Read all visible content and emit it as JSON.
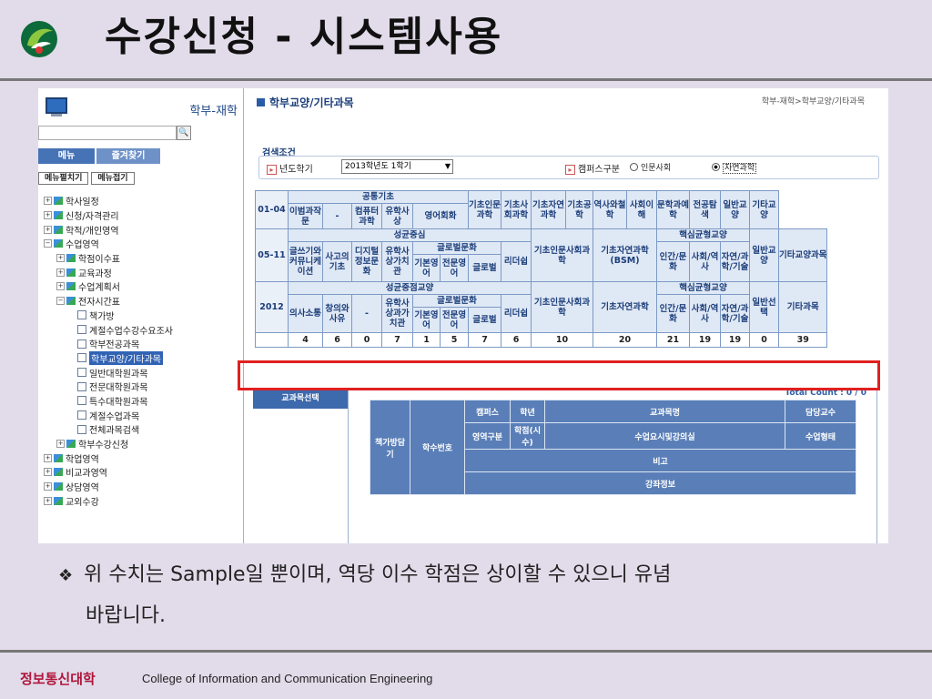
{
  "slide": {
    "title": "수강신청 - 시스템사용",
    "logo_icon": "university-emblem-icon",
    "bullet": "위 수치는 Sample일 뿐이며, 역당 이수 학점은 상이할 수 있으니 유념",
    "bullet2": "바랍니다.",
    "footer_kr": "정보통신대학",
    "footer_en": "College of Information and Communication Engineering",
    "highlight_color": "#e02020"
  },
  "sidebar": {
    "title": "학부-재학",
    "search_button": "🔍",
    "tab_menu": "메뉴",
    "tab_fav": "즐겨찾기",
    "expand": "메뉴펼치기",
    "collapse": "메뉴접기",
    "items": [
      {
        "label": "학사일정",
        "pm": "+",
        "icon": "g",
        "indent": 0
      },
      {
        "label": "신청/자격관리",
        "pm": "+",
        "icon": "g",
        "indent": 0
      },
      {
        "label": "학적/개인영역",
        "pm": "+",
        "icon": "g",
        "indent": 0
      },
      {
        "label": "수업영역",
        "pm": "−",
        "icon": "g",
        "indent": 0
      },
      {
        "label": "학점이수표",
        "pm": "+",
        "icon": "g",
        "indent": 1
      },
      {
        "label": "교육과정",
        "pm": "+",
        "icon": "g",
        "indent": 1
      },
      {
        "label": "수업계획서",
        "pm": "+",
        "icon": "g",
        "indent": 1
      },
      {
        "label": "전자시간표",
        "pm": "−",
        "icon": "g",
        "indent": 1
      },
      {
        "label": "책가방",
        "pm": "",
        "icon": "d",
        "indent": 2
      },
      {
        "label": "계절수업수강수요조사",
        "pm": "",
        "icon": "d",
        "indent": 2
      },
      {
        "label": "학부전공과목",
        "pm": "",
        "icon": "d",
        "indent": 2
      },
      {
        "label": "학부교양/기타과목",
        "pm": "",
        "icon": "d",
        "indent": 2,
        "selected": true
      },
      {
        "label": "일반대학원과목",
        "pm": "",
        "icon": "d",
        "indent": 2
      },
      {
        "label": "전문대학원과목",
        "pm": "",
        "icon": "d",
        "indent": 2
      },
      {
        "label": "특수대학원과목",
        "pm": "",
        "icon": "d",
        "indent": 2
      },
      {
        "label": "계절수업과목",
        "pm": "",
        "icon": "d",
        "indent": 2
      },
      {
        "label": "전체과목검색",
        "pm": "",
        "icon": "d",
        "indent": 2
      },
      {
        "label": "학부수강신청",
        "pm": "+",
        "icon": "g",
        "indent": 1
      },
      {
        "label": "학업영역",
        "pm": "+",
        "icon": "g",
        "indent": 0
      },
      {
        "label": "비교과영역",
        "pm": "+",
        "icon": "g",
        "indent": 0
      },
      {
        "label": "상담영역",
        "pm": "+",
        "icon": "g",
        "indent": 0
      },
      {
        "label": "교외수강",
        "pm": "+",
        "icon": "g",
        "indent": 0
      }
    ]
  },
  "main": {
    "page_title": "학부교양/기타과목",
    "breadcrumb": "학부-재학>학부교양/기타과목",
    "search_label": "검색조건",
    "year_label": "년도학기",
    "year_value": "2013학년도 1학기",
    "campus_label": "캠퍼스구분",
    "campus_opt1": "인문사회",
    "campus_opt2": "자연과학",
    "total": "Total Count : 0 / 0",
    "select_tab": "교과목선택",
    "result_headers": {
      "bag": "책가방담기",
      "code": "학수번호",
      "campus": "캠퍼스",
      "grade": "학년",
      "name": "교과목명",
      "prof": "담당교수",
      "area": "영역구분",
      "credit": "학점(시수)",
      "time": "수업요시및강의실",
      "type": "수업형태",
      "note": "비고",
      "info": "강좌정보"
    }
  },
  "grid": {
    "r1": [
      "01-04",
      "공통기초",
      "이범과작문",
      "-",
      "컴퓨터과학",
      "유학사상",
      "영어회화",
      "기초인문과학",
      "기초사회과학",
      "기초자연과학",
      "기초공학",
      "역사와철학",
      "사회이해",
      "문학과예학",
      "전공탐색",
      "일반교양",
      "기타교양"
    ],
    "r2": [
      "05-11",
      "성균중심",
      "글쓰기와커뮤니케이션",
      "사고의기초",
      "디지털정보문화",
      "유학사상가치관",
      "글로벌문화",
      "기본영어",
      "전문영어",
      "글로벌",
      "리더쉽",
      "기초인문사회과학",
      "기초자연과학(BSM)",
      "핵심균형교양",
      "인간/문화",
      "사회/역사",
      "자연/과학/기술",
      "일반교양",
      "기타교양과목"
    ],
    "r3": [
      "2012",
      "성균중점교양",
      "의사소통",
      "창의와사유",
      "-",
      "유학사상과가치관",
      "글로벌문화",
      "기본영어",
      "전문영어",
      "글로벌",
      "리더쉽",
      "기초인문사회과학",
      "기초자연과학",
      "핵심균형교양",
      "인간/문화",
      "사회/역사",
      "자연/과학/기술",
      "일반선택",
      "기타과목"
    ],
    "vals": [
      "4",
      "6",
      "0",
      "7",
      "1",
      "5",
      "7",
      "6",
      "10",
      "20",
      "21",
      "19",
      "19",
      "0",
      "39"
    ]
  }
}
